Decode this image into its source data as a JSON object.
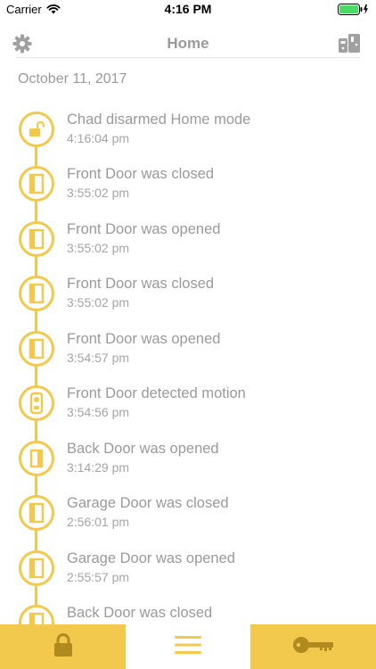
{
  "status_bar": {
    "carrier": "Carrier",
    "time": "4:16 PM"
  },
  "nav": {
    "title": "Home",
    "left_icon": "gear-icon",
    "right_icon": "devices-icon"
  },
  "date_header": "October 11, 2017",
  "events": [
    {
      "title": "Chad disarmed Home mode",
      "time": "4:16:04 pm",
      "icon": "unlock-icon"
    },
    {
      "title": "Front Door was closed",
      "time": "3:55:02 pm",
      "icon": "door-icon"
    },
    {
      "title": "Front Door was opened",
      "time": "3:55:02 pm",
      "icon": "door-icon"
    },
    {
      "title": "Front Door was closed",
      "time": "3:55:02 pm",
      "icon": "door-icon"
    },
    {
      "title": "Front Door was opened",
      "time": "3:54:57 pm",
      "icon": "door-icon"
    },
    {
      "title": "Front Door detected motion",
      "time": "3:54:56 pm",
      "icon": "doorbell-camera-icon"
    },
    {
      "title": "Back Door was opened",
      "time": "3:14:29 pm",
      "icon": "door-icon"
    },
    {
      "title": "Garage Door was closed",
      "time": "2:56:01 pm",
      "icon": "door-icon"
    },
    {
      "title": "Garage Door was opened",
      "time": "2:55:57 pm",
      "icon": "door-icon"
    },
    {
      "title": "Back Door was closed",
      "time": "",
      "icon": "door-icon"
    }
  ],
  "tab_bar": {
    "tabs": [
      {
        "name": "lock",
        "icon": "lock-icon",
        "selected": false
      },
      {
        "name": "menu",
        "icon": "menu-icon",
        "selected": true
      },
      {
        "name": "key",
        "icon": "key-icon",
        "selected": false
      }
    ]
  },
  "colors": {
    "accent": "#f2c94c",
    "icon_dark": "#b08a1e",
    "text_gray": "#9a9a9a",
    "battery_green": "#4cd964"
  }
}
